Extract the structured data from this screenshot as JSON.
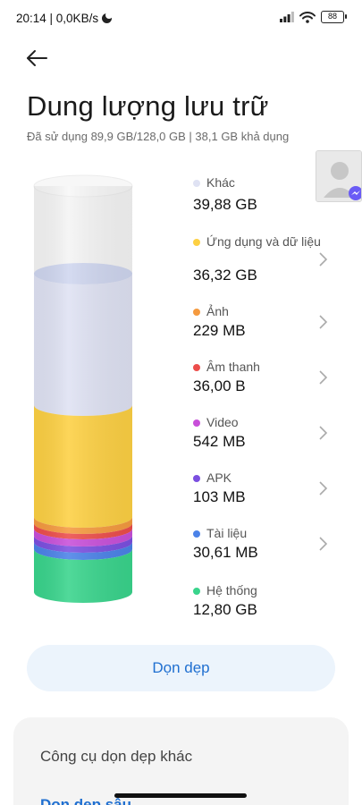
{
  "status_bar": {
    "time_speed": "20:14 | 0,0KB/s",
    "battery": "88"
  },
  "header": {
    "title": "Dung lượng lưu trữ",
    "subtitle": "Đã sử dụng 89,9 GB/128,0 GB | 38,1 GB khả dụng"
  },
  "colors": {
    "khac": "#dfe2f3",
    "ung_dung": "#fdd043",
    "anh": "#f59a3f",
    "am_thanh": "#ec4d4b",
    "video": "#c84fd9",
    "apk": "#7b4fe0",
    "tai_lieu": "#4b82e8",
    "he_thong": "#39d48c",
    "accent": "#1f6fd0"
  },
  "storage_items": [
    {
      "name": "Khác",
      "size": "39,88 GB",
      "color": "#dfe2f3",
      "chevron": false
    },
    {
      "name": "Ứng dụng và dữ liệu",
      "size": "36,32 GB",
      "color": "#fdd043",
      "chevron": true
    },
    {
      "name": "Ảnh",
      "size": "229 MB",
      "color": "#f59a3f",
      "chevron": true
    },
    {
      "name": "Âm thanh",
      "size": "36,00 B",
      "color": "#ec4d4b",
      "chevron": true
    },
    {
      "name": "Video",
      "size": "542 MB",
      "color": "#c84fd9",
      "chevron": true
    },
    {
      "name": "APK",
      "size": "103 MB",
      "color": "#7b4fe0",
      "chevron": true
    },
    {
      "name": "Tài liệu",
      "size": "30,61 MB",
      "color": "#4b82e8",
      "chevron": true
    },
    {
      "name": "Hệ thống",
      "size": "12,80 GB",
      "color": "#39d48c",
      "chevron": false
    }
  ],
  "clean_button": "Dọn dẹp",
  "tools": {
    "title": "Công cụ dọn dẹp khác",
    "next_label": "Dọn dẹp sâu"
  }
}
